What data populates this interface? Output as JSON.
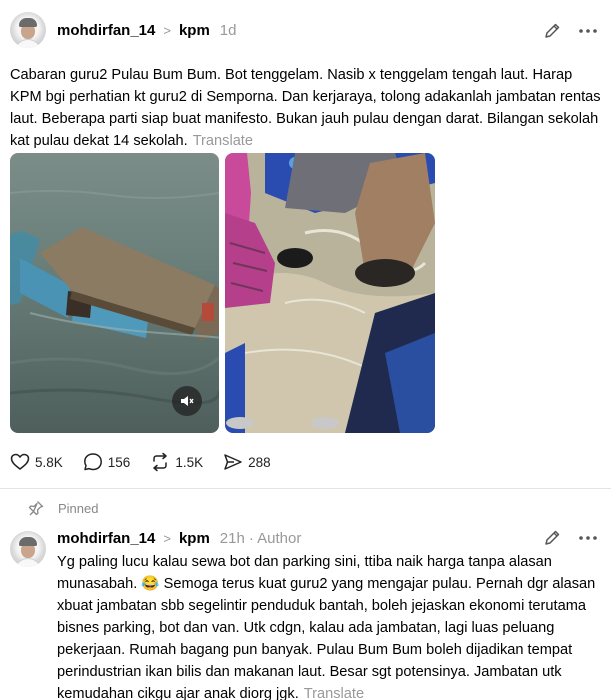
{
  "post": {
    "username": "mohdirfan_14",
    "separator": ">",
    "topic": "kpm",
    "time": "1d",
    "text": "Cabaran guru2 Pulau Bum Bum. Bot tenggelam. Nasib x tenggelam tengah laut. Harap KPM bgi perhatian kt guru2 di Semporna. Dan kerjaraya, tolong adakanlah jambatan rentas laut. Beberapa parti siap buat manifesto. Bukan jauh pulau dengan darat. Bilangan sekolah kat pulau dekat 14 sekolah.",
    "translate": "Translate",
    "actions": {
      "likes": "5.8K",
      "comments": "156",
      "reposts": "1.5K",
      "shares": "288"
    }
  },
  "reply": {
    "pinned_label": "Pinned",
    "username": "mohdirfan_14",
    "separator": ">",
    "topic": "kpm",
    "time": "21h",
    "author_label": "· Author",
    "text_part1": "Yg paling lucu kalau sewa bot dan parking sini, ttiba naik harga tanpa alasan munasabah.",
    "emoji": "😂",
    "text_part2": "Semoga terus kuat guru2 yang mengajar pulau. Pernah dgr alasan xbuat jambatan sbb segelintir penduduk bantah, boleh jejaskan ekonomi terutama bisnes parking, bot dan van. Utk cdgn, kalau ada jambatan, lagi luas peluang pekerjaan. Rumah bagang pun banyak. Pulau Bum Bum boleh dijadikan tempat perindustrian ikan bilis dan makanan laut. Besar sgt potensinya. Jambatan utk kemudahan cikgu ajar anak diorg jgk.",
    "translate": "Translate"
  },
  "icons": {
    "edit": "pencil-icon",
    "more": "more-dots-icon",
    "like": "heart-icon",
    "comment": "comment-bubble-icon",
    "repost": "repost-arrows-icon",
    "share": "send-paper-plane-icon",
    "mute": "speaker-muted-icon",
    "pin": "pin-icon"
  },
  "colors": {
    "text": "#000000",
    "muted": "#999999",
    "divider": "#e4e4e4"
  }
}
